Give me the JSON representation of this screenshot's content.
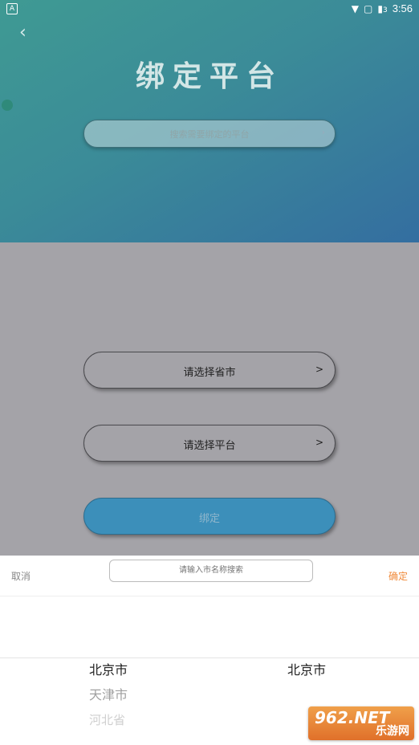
{
  "status_bar": {
    "notification_icon": "A",
    "time": "3:56",
    "icons": [
      "wifi-icon",
      "sim-icon",
      "battery-icon"
    ],
    "battery_text": "3"
  },
  "header": {
    "back_icon": "‹",
    "title": "绑定平台",
    "search_placeholder": "搜索需要绑定的平台"
  },
  "form": {
    "province_label": "请选择省市",
    "platform_label": "请选择平台",
    "arrow": ">",
    "bind_label": "绑定"
  },
  "picker": {
    "cancel_label": "取消",
    "confirm_label": "确定",
    "search_placeholder": "请输入市名称搜索",
    "provinces": [
      "北京市",
      "天津市",
      "河北省"
    ],
    "cities": [
      "北京市"
    ]
  },
  "watermark": {
    "brand": "962.NET",
    "subtitle": "乐游网"
  },
  "colors": {
    "accent": "#3c8fba",
    "confirm": "#f08a3a"
  }
}
